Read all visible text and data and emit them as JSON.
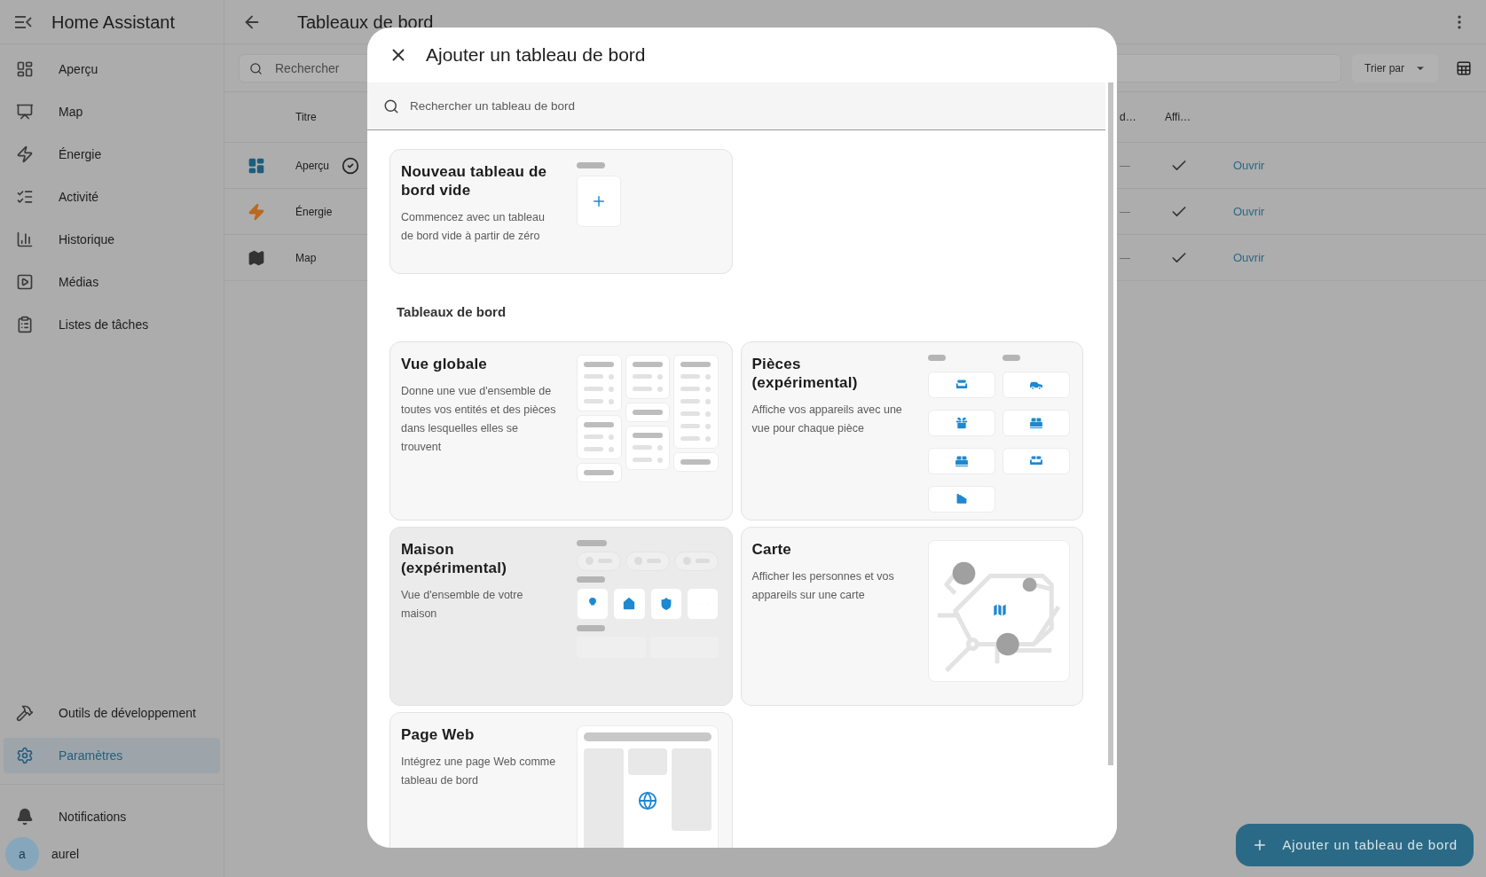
{
  "app": {
    "title": "Home Assistant"
  },
  "sidebar": {
    "items": [
      {
        "label": "Aperçu",
        "selected": false
      },
      {
        "label": "Map",
        "selected": false
      },
      {
        "label": "Énergie",
        "selected": false
      },
      {
        "label": "Activité",
        "selected": false
      },
      {
        "label": "Historique",
        "selected": false
      },
      {
        "label": "Médias",
        "selected": false
      },
      {
        "label": "Listes de tâches",
        "selected": false
      }
    ],
    "bottom_items": [
      {
        "label": "Outils de développement",
        "selected": false
      },
      {
        "label": "Paramètres",
        "selected": true
      }
    ],
    "notifications": "Notifications",
    "user": {
      "initial": "a",
      "name": "aurel"
    }
  },
  "page": {
    "title": "Tableaux de bord",
    "search": {
      "placeholder": "Rechercher"
    },
    "sort_button": "Trier par"
  },
  "table": {
    "columns": [
      "Titre",
      "d…",
      "Affi…"
    ],
    "rows": [
      {
        "title": "Aperçu",
        "default": true,
        "column_3": "—",
        "shown": true,
        "action": "Ouvrir"
      },
      {
        "title": "Énergie",
        "default": false,
        "column_3": "—",
        "shown": true,
        "action": "Ouvrir"
      },
      {
        "title": "Map",
        "default": false,
        "column_3": "—",
        "shown": true,
        "action": "Ouvrir"
      }
    ]
  },
  "fab": "Ajouter un tableau de bord",
  "dialog": {
    "title": "Ajouter un tableau de bord",
    "search": {
      "placeholder": "Rechercher un tableau de bord"
    },
    "new_card": {
      "title": "Nouveau tableau de bord vide",
      "description": "Commencez avec un tableau de bord vide à partir de zéro"
    },
    "section_title": "Tableaux de bord",
    "cards": [
      {
        "kind": "overview",
        "title": "Vue globale",
        "description": "Donne une vue d'ensemble de toutes vos entités et des pièces dans lesquelles elles se trouvent",
        "highlighted": false
      },
      {
        "kind": "rooms",
        "title": "Pièces (expérimental)",
        "description": "Affiche vos appareils avec une vue pour chaque pièce",
        "highlighted": false
      },
      {
        "kind": "home",
        "title": "Maison (expérimental)",
        "description": "Vue d'ensemble de votre maison",
        "highlighted": true
      },
      {
        "kind": "map",
        "title": "Carte",
        "description": "Afficher les personnes et vos appareils sur une carte",
        "highlighted": false
      },
      {
        "kind": "webpage",
        "title": "Page Web",
        "description": "Intégrez une page Web comme tableau de bord",
        "highlighted": false
      }
    ]
  }
}
